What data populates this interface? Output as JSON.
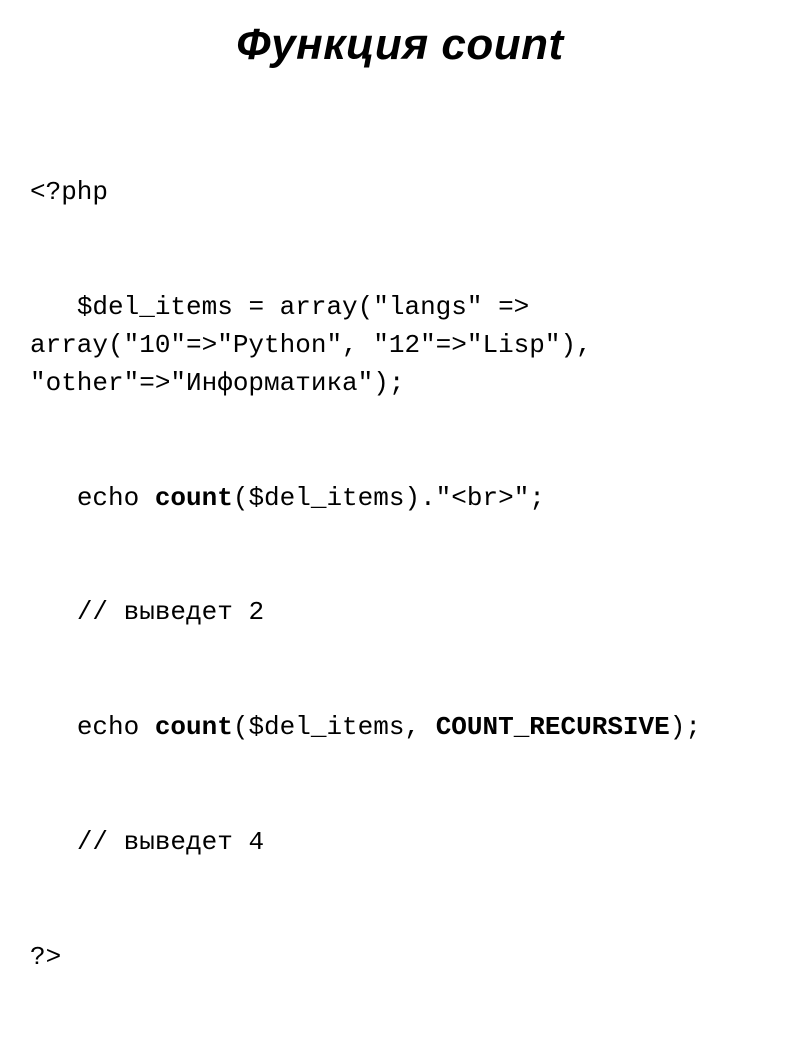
{
  "title": "Функция count",
  "code": {
    "l1": "<?php",
    "l2a": "   $del_items = array(\"langs\" => ",
    "l2b": "array(\"10\"=>\"Python\", \"12\"=>\"Lisp\"), \"other\"=>\"Информатика\");",
    "l3a": "   echo ",
    "l3b": "count",
    "l3c": "($del_items).\"<br>\";",
    "l4": "   // выведет 2",
    "l5a": "   echo ",
    "l5b": "count",
    "l5c": "($del_items, ",
    "l5d": "COUNT_RECURSIVE",
    "l5e": ");",
    "l6": "   // выведет 4",
    "l7": "?>"
  }
}
